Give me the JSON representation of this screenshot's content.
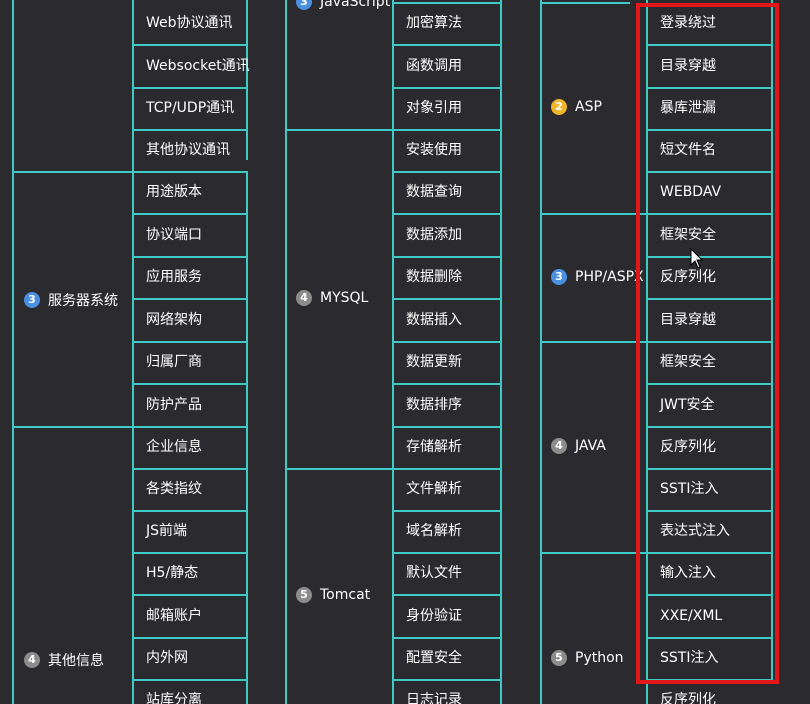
{
  "columns": [
    {
      "groups": [
        {
          "badge": "3",
          "badge_color": "#4a8fe0",
          "label": "服务器系统"
        },
        {
          "badge": "4",
          "badge_color": "#8c8c8c",
          "label": "其他信息"
        }
      ],
      "items": [
        "Web协议通讯",
        "Websocket通讯",
        "TCP/UDP通讯",
        "其他协议通讯",
        "用途版本",
        "协议端口",
        "应用服务",
        "网络架构",
        "归属厂商",
        "防护产品",
        "企业信息",
        "各类指纹",
        "JS前端",
        "H5/静态",
        "邮箱账户",
        "内外网",
        "站库分离"
      ]
    },
    {
      "groups": [
        {
          "badge": "3",
          "badge_color": "#4a8fe0",
          "label": "JavaScript"
        },
        {
          "badge": "4",
          "badge_color": "#8c8c8c",
          "label": "MYSQL"
        },
        {
          "badge": "5",
          "badge_color": "#8c8c8c",
          "label": "Tomcat"
        }
      ],
      "items": [
        "加密算法",
        "函数调用",
        "对象引用",
        "安装使用",
        "数据查询",
        "数据添加",
        "数据删除",
        "数据插入",
        "数据更新",
        "数据排序",
        "存储解析",
        "文件解析",
        "域名解析",
        "默认文件",
        "身份验证",
        "配置安全",
        "日志记录"
      ]
    },
    {
      "groups": [
        {
          "badge": "2",
          "badge_color": "#f0b429",
          "label": "ASP"
        },
        {
          "badge": "3",
          "badge_color": "#4a8fe0",
          "label": "PHP/ASPX"
        },
        {
          "badge": "4",
          "badge_color": "#8c8c8c",
          "label": "JAVA"
        },
        {
          "badge": "5",
          "badge_color": "#8c8c8c",
          "label": "Python"
        }
      ],
      "items": [
        "登录绕过",
        "目录穿越",
        "暴库泄漏",
        "短文件名",
        "WEBDAV",
        "框架安全",
        "反序列化",
        "目录穿越",
        "框架安全",
        "JWT安全",
        "反序列化",
        "SSTI注入",
        "表达式注入",
        "输入注入",
        "XXE/XML",
        "SSTI注入",
        "反序列化"
      ]
    }
  ],
  "colors": {
    "background": "#2b2a2f",
    "line": "#3fc9c4",
    "highlight": "#e3161a"
  }
}
